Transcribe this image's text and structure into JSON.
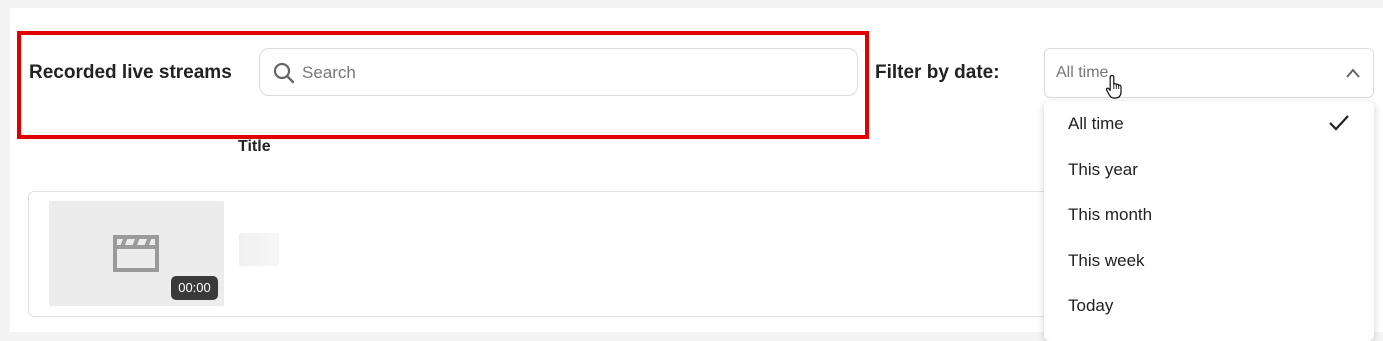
{
  "header": {
    "section_title": "Recorded live streams",
    "search": {
      "placeholder": "Search",
      "value": ""
    },
    "filter": {
      "label": "Filter by date:",
      "selected": "All time",
      "expanded": true
    }
  },
  "table": {
    "column_title": "Title",
    "rows": [
      {
        "duration": "00:00",
        "title": ""
      }
    ]
  },
  "dropdown": {
    "options": [
      {
        "label": "All time",
        "selected": true
      },
      {
        "label": "This year",
        "selected": false
      },
      {
        "label": "This month",
        "selected": false
      },
      {
        "label": "This week",
        "selected": false
      },
      {
        "label": "Today",
        "selected": false
      }
    ]
  },
  "colors": {
    "highlight": "#e00000",
    "duration_badge": "#3a3a3a",
    "thumbnail_bg": "#ececec"
  },
  "icons": {
    "search": "search-icon",
    "chevron": "chevron-up-icon",
    "check": "check-icon",
    "thumbnail": "clapperboard-icon",
    "cursor": "hand-pointer-icon"
  }
}
